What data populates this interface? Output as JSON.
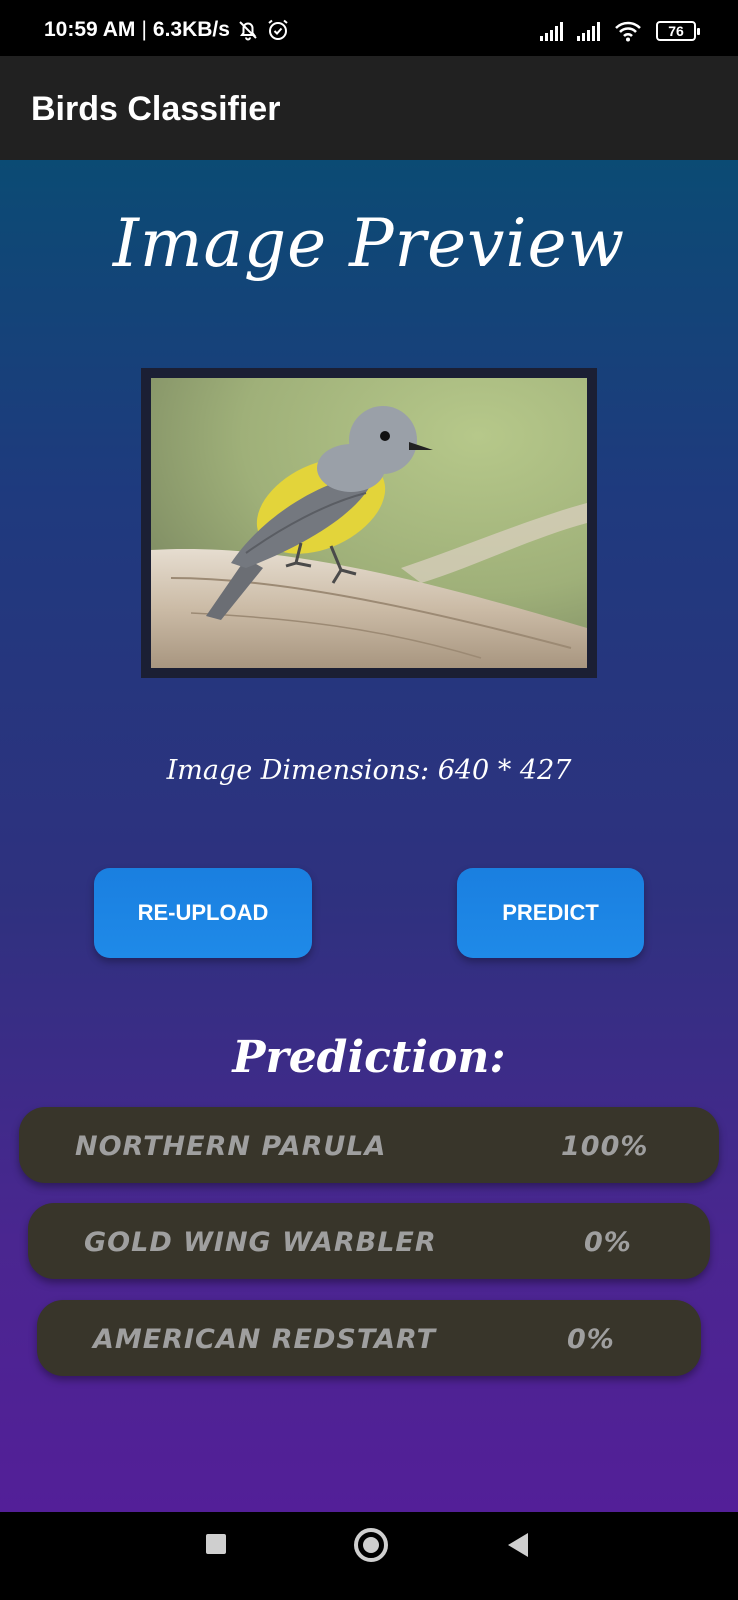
{
  "status_bar": {
    "time": "10:59 AM",
    "net_speed": "6.3KB/s",
    "battery": "76",
    "icons": [
      "mute-bell-icon",
      "alarm-icon",
      "signal-icon",
      "signal-icon",
      "wifi-icon",
      "battery-icon"
    ]
  },
  "app_bar": {
    "title": "Birds Classifier"
  },
  "preview": {
    "title": "Image Preview",
    "dimensions_text": "Image Dimensions: 640 * 427"
  },
  "buttons": {
    "reupload": "RE-UPLOAD",
    "predict": "PREDICT"
  },
  "prediction": {
    "heading": "Prediction:",
    "results": [
      {
        "label": "NORTHERN PARULA",
        "value": "100%"
      },
      {
        "label": "GOLD WING WARBLER",
        "value": "0%"
      },
      {
        "label": "AMERICAN REDSTART",
        "value": "0%"
      }
    ]
  },
  "colors": {
    "button": "#1f8ae8",
    "app_bar": "#212121",
    "result_row": "#38352a",
    "gradient_top": "#0b4b74",
    "gradient_bottom": "#531f98"
  },
  "nav_bar": {
    "icons": [
      "recents-square-icon",
      "home-circle-icon",
      "back-triangle-icon"
    ]
  }
}
